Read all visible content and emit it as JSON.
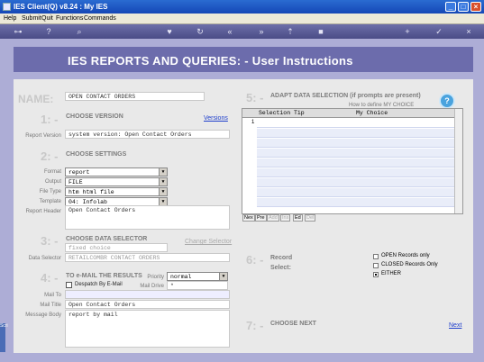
{
  "window": {
    "title": "IES Client(Q) v8.24 : My IES"
  },
  "menu": [
    "Help",
    "Submit",
    "Quit",
    "Functions",
    "Commands"
  ],
  "toolbar_icons": [
    "key-icon",
    "help-icon",
    "search-icon",
    "heart-icon",
    "refresh-icon",
    "rewind-icon",
    "forward-icon",
    "upload-icon",
    "stop-icon",
    "add-icon",
    "check-icon",
    "close-icon"
  ],
  "header": {
    "title": "IES REPORTS AND QUERIES: -   User Instructions"
  },
  "name": {
    "label": "NAME:",
    "value": "OPEN CONTACT ORDERS"
  },
  "s1": {
    "num": "1: -",
    "title": "CHOOSE VERSION",
    "link": "Versions",
    "version_label": "Report Version",
    "version_value": "system version: Open Contact Orders"
  },
  "s2": {
    "num": "2: -",
    "title": "CHOOSE SETTINGS",
    "fields": [
      {
        "label": "Format",
        "value": "report"
      },
      {
        "label": "Output",
        "value": "FILE"
      },
      {
        "label": "File Type",
        "value": "htm html file"
      },
      {
        "label": "Template",
        "value": "04: Infolab"
      }
    ],
    "report_header_label": "Report Header",
    "report_header_value": "Open Contact Orders"
  },
  "s3": {
    "num": "3: -",
    "title": "CHOOSE DATA SELECTOR",
    "link": "Change Selector",
    "value": "fixed choice",
    "selector_label": "Data Selector",
    "selector_value": "RETAILCOMBR CONTACT ORDERS"
  },
  "s4": {
    "num": "4: -",
    "title": "TO e-MAIL THE RESULTS",
    "priority_label": "Priority",
    "priority_value": "normal",
    "despatch_label": "Despatch By E-Mail",
    "maildrive_label": "Mail Drive",
    "maildrive_value": "*",
    "mailto_label": "Mail To",
    "mailtitle_label": "Mail Title",
    "mailtitle_value": "Open Contact Orders",
    "body_label": "Message Body",
    "body_value": "report by mail"
  },
  "s5": {
    "num": "5: -",
    "title": "ADAPT DATA SELECTION (if prompts are present)",
    "subtitle": "How to define MY CHOICE",
    "col1": "Selection Tip",
    "col2": "My Choice",
    "first_row_num": "1",
    "buttons": [
      "Nex",
      "Pre",
      "Add",
      "Ins",
      "Ed",
      "Del"
    ]
  },
  "s6": {
    "num": "6: -",
    "record_label": "Record",
    "select_label": "Select:",
    "options": [
      "OPEN Records only",
      "CLOSED Records Only",
      "EITHER"
    ],
    "selected": "EITHER"
  },
  "s7": {
    "num": "7: -",
    "title": "CHOOSE NEXT",
    "link": "Next"
  },
  "help_icon": "?",
  "sidebar_label": "Scri"
}
